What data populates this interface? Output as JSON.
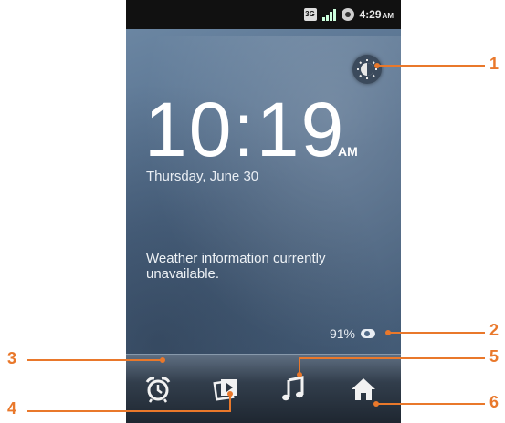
{
  "statusbar": {
    "network": "3G",
    "time": "4:29",
    "ampm": "AM"
  },
  "clock": {
    "time": "10:19",
    "ampm": "AM",
    "date": "Thursday, June 30"
  },
  "weather": {
    "message": "Weather information currently unavailable."
  },
  "battery": {
    "percent_label": "91%"
  },
  "dock": {
    "items": [
      "alarm-icon",
      "gallery-icon",
      "music-icon",
      "home-icon"
    ]
  },
  "callouts": [
    "1",
    "2",
    "3",
    "4",
    "5",
    "6"
  ],
  "colors": {
    "callout": "#e9782b",
    "statusbar": "#111111",
    "wallpaper": "#4f6987"
  }
}
